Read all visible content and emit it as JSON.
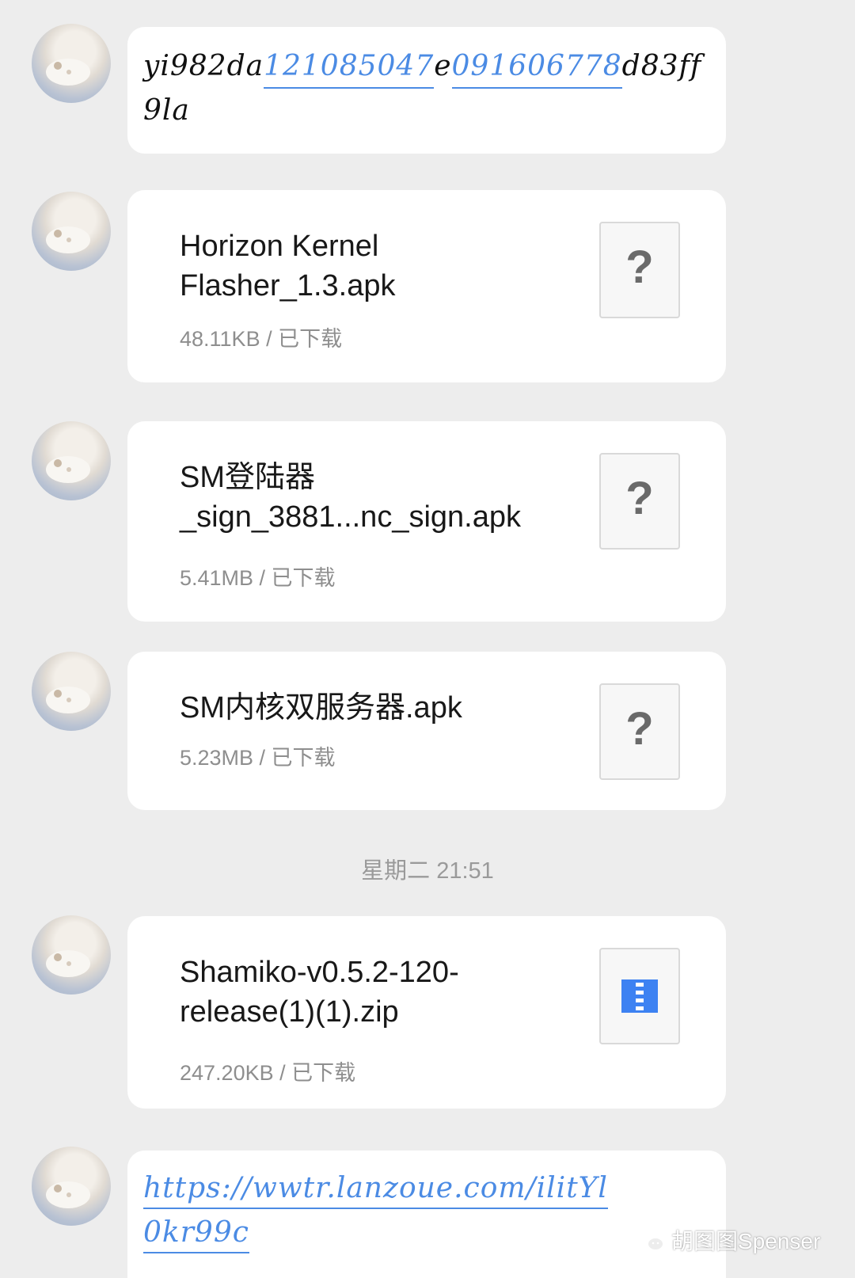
{
  "message1": {
    "part1": "yi982da",
    "num1": "121085047",
    "part2": "e",
    "num2": "091606778",
    "part3": "d83ff9",
    "part4": "la"
  },
  "files": [
    {
      "name_line1": "Horizon Kernel",
      "name_line2": "Flasher_1.3.apk",
      "meta": "48.11KB / 已下载",
      "icon": "unknown-file-icon",
      "icon_glyph": "?"
    },
    {
      "name_line1": "SM登陆器",
      "name_line2": "_sign_3881...nc_sign.apk",
      "meta": "5.41MB / 已下载",
      "icon": "unknown-file-icon",
      "icon_glyph": "?"
    },
    {
      "name_line1": "SM内核双服务器.apk",
      "name_line2": "",
      "meta": "5.23MB / 已下载",
      "icon": "unknown-file-icon",
      "icon_glyph": "?"
    },
    {
      "name_line1": "Shamiko-v0.5.2-120-",
      "name_line2": "release(1)(1).zip",
      "meta": "247.20KB / 已下载",
      "icon": "zip-file-icon"
    }
  ],
  "timestamp": "星期二 21:51",
  "link": {
    "line1": "https://wwtr.lanzoue.com/ilitYl",
    "line2": "0kr99c"
  },
  "watermark": "胡图图Spenser",
  "colors": {
    "link": "#4b8be4",
    "background": "#ededed",
    "zip": "#3d82f2"
  }
}
